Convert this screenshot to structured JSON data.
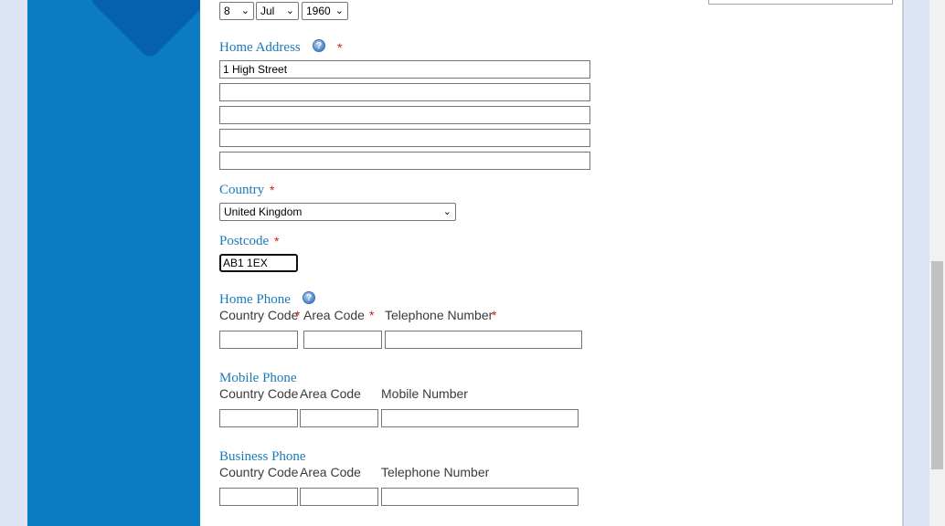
{
  "dob": {
    "day": "8",
    "month": "Jul",
    "year": "1960"
  },
  "home_address": {
    "label": "Home Address",
    "required_mark": "*",
    "lines": [
      "1 High Street",
      "",
      "",
      "",
      ""
    ]
  },
  "country": {
    "label": "Country",
    "required_mark": "*",
    "value": "United Kingdom"
  },
  "postcode": {
    "label": "Postcode",
    "required_mark": "*",
    "value": "AB1 1EX"
  },
  "home_phone": {
    "label": "Home Phone",
    "country_code_label": "Country Code",
    "area_code_label": "Area Code",
    "number_label": "Telephone Number",
    "required_mark": "*"
  },
  "mobile_phone": {
    "label": "Mobile Phone",
    "country_code_label": "Country Code",
    "area_code_label": "Area Code",
    "number_label": "Mobile Number"
  },
  "business_phone": {
    "label": "Business Phone",
    "country_code_label": "Country Code",
    "area_code_label": "Area Code",
    "number_label": "Telephone Number"
  },
  "icons": {
    "help": "help-question-icon",
    "dropdown": "chevron-down-icon"
  },
  "colors": {
    "sidebar": "#0b7cc1",
    "label": "#1a7ab8",
    "required": "#cc1f1f",
    "page_bg": "#dde4f3"
  }
}
